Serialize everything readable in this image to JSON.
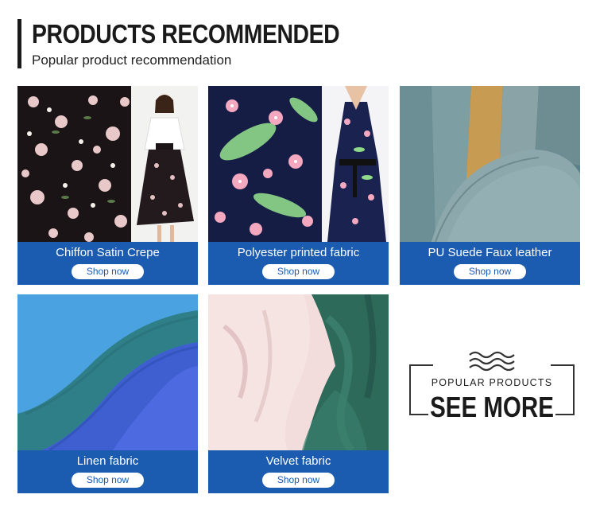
{
  "header": {
    "title": "PRODUCTS RECOMMENDED",
    "subtitle": "Popular product recommendation"
  },
  "products": [
    {
      "name": "Chiffon Satin Crepe",
      "button": "Shop now"
    },
    {
      "name": "Polyester printed fabric",
      "button": "Shop now"
    },
    {
      "name": "PU Suede Faux leather",
      "button": "Shop now"
    },
    {
      "name": "Linen fabric",
      "button": "Shop now"
    },
    {
      "name": "Velvet fabric",
      "button": "Shop now"
    }
  ],
  "see_more": {
    "kicker": "POPULAR PRODUCTS",
    "label": "SEE MORE"
  },
  "colors": {
    "card_caption_bg": "#1b5bb0",
    "button_bg": "#ffffff",
    "title_text": "#1a1a1a"
  }
}
